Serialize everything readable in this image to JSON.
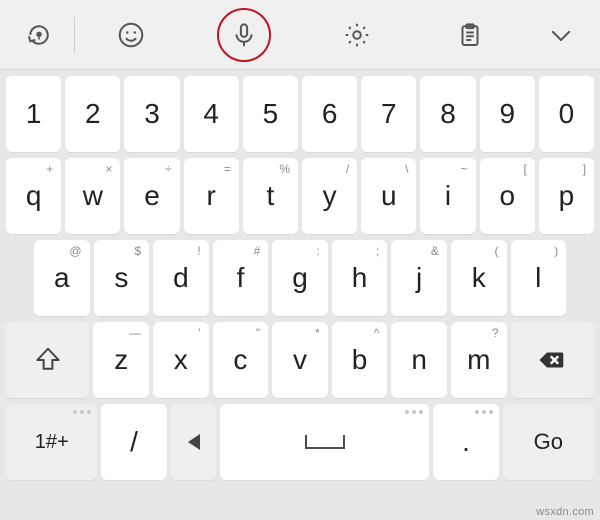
{
  "toolbar": {
    "icons": [
      "theme-bulb",
      "emoji",
      "mic",
      "settings-gear",
      "clipboard",
      "chevron-down"
    ]
  },
  "keyboard": {
    "row_numbers": [
      "1",
      "2",
      "3",
      "4",
      "5",
      "6",
      "7",
      "8",
      "9",
      "0"
    ],
    "row_qwerty": {
      "keys": [
        "q",
        "w",
        "e",
        "r",
        "t",
        "y",
        "u",
        "i",
        "o",
        "p"
      ],
      "sups": [
        "+",
        "×",
        "÷",
        "=",
        "%",
        "/",
        "\\",
        "~",
        "[",
        "]"
      ]
    },
    "row_asdf": {
      "keys": [
        "a",
        "s",
        "d",
        "f",
        "g",
        "h",
        "j",
        "k",
        "l"
      ],
      "sups": [
        "@",
        "$",
        "!",
        "#",
        ":",
        ";",
        "&",
        "(",
        ")"
      ]
    },
    "row_zxcv": {
      "keys": [
        "z",
        "x",
        "c",
        "v",
        "b",
        "n",
        "m"
      ],
      "sups": [
        "—",
        "'",
        "\"",
        "*",
        "^",
        "",
        "?"
      ]
    },
    "bottom": {
      "symbols_label": "1#+",
      "slash_label": "/",
      "period_label": ".",
      "go_label": "Go"
    }
  },
  "watermark": "wsxdn.com"
}
